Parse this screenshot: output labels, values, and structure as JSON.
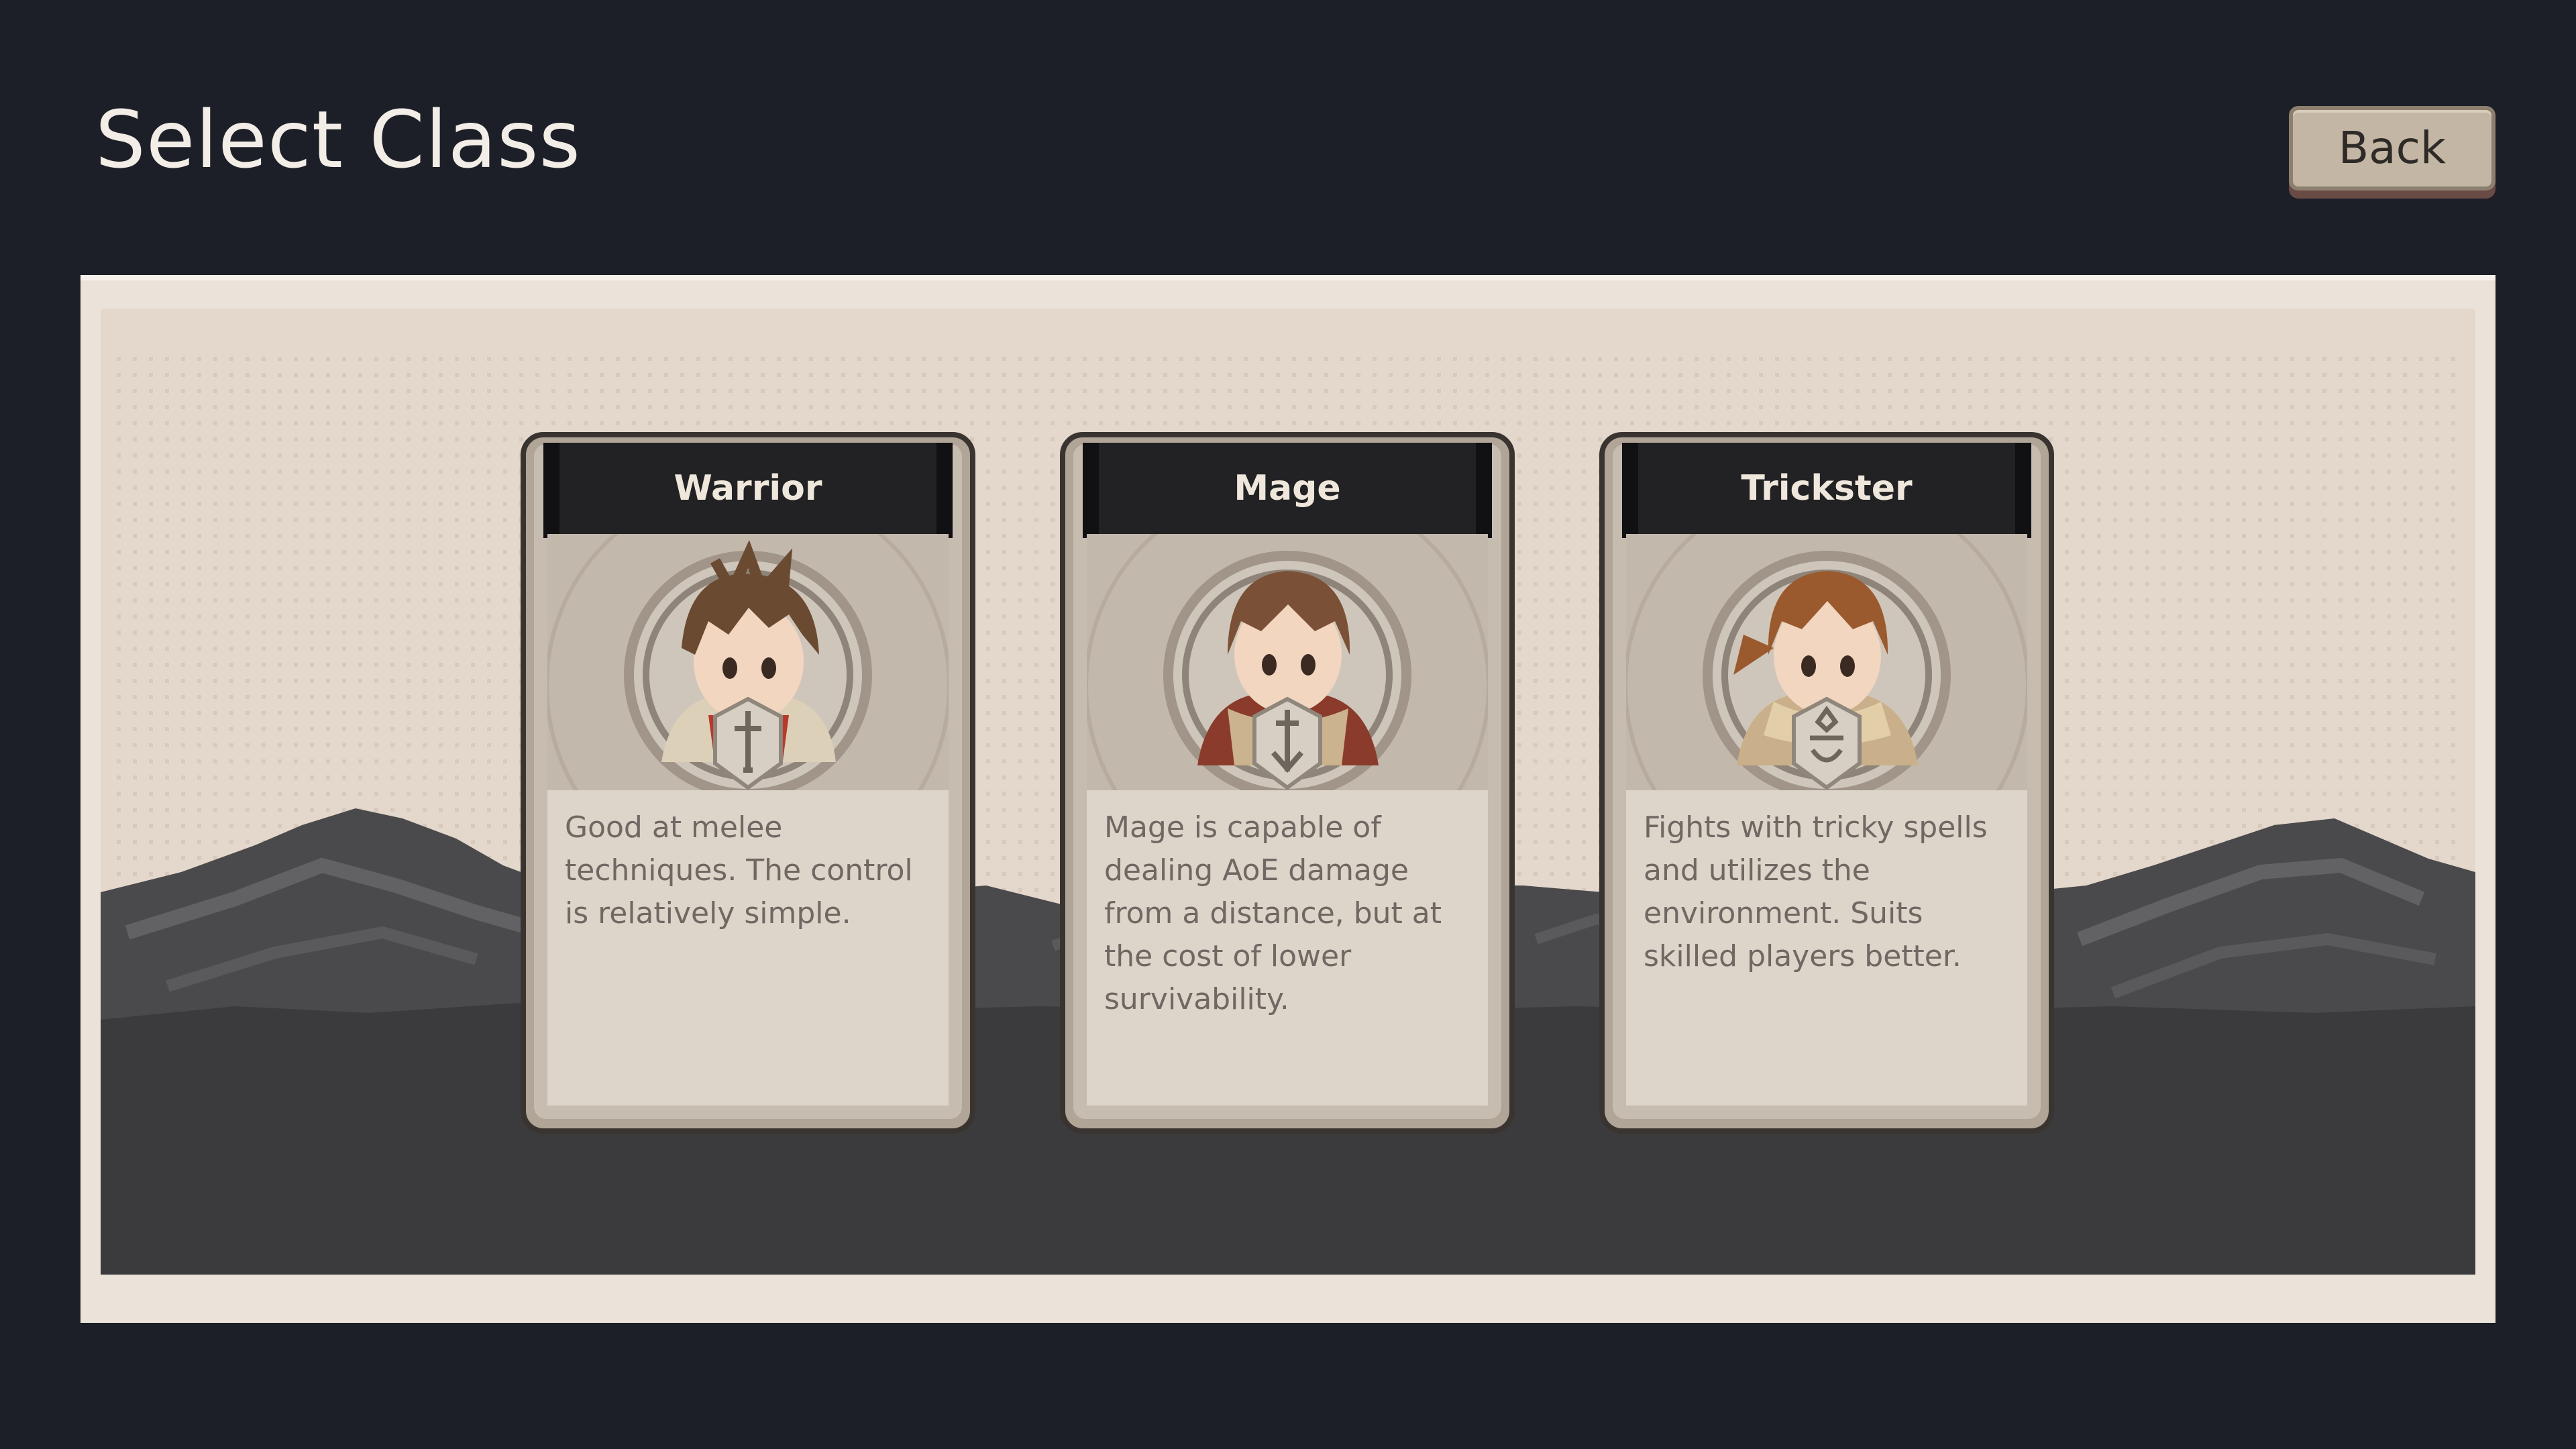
{
  "header": {
    "title": "Select Class",
    "back_label": "Back"
  },
  "classes": [
    {
      "name": "Warrior",
      "description": "Good at melee techniques. The control is relatively simple.",
      "emblem": "sword-icon",
      "shirt_color": "#b8392b"
    },
    {
      "name": "Mage",
      "description": "Mage is capable of dealing AoE damage from a distance, but at the cost of lower survivability.",
      "emblem": "staff-icon",
      "shirt_color": "#8a3b2b"
    },
    {
      "name": "Trickster",
      "description": "Fights with tricky spells and utilizes the environment. Suits skilled players better.",
      "emblem": "crown-icon",
      "shirt_color": "#c9b08a"
    }
  ],
  "colors": {
    "background": "#1c1f27",
    "board": "#ebe3da",
    "sky": "#e4d7cb",
    "mountain": "#3b3b3d",
    "card_header": "#222224"
  }
}
